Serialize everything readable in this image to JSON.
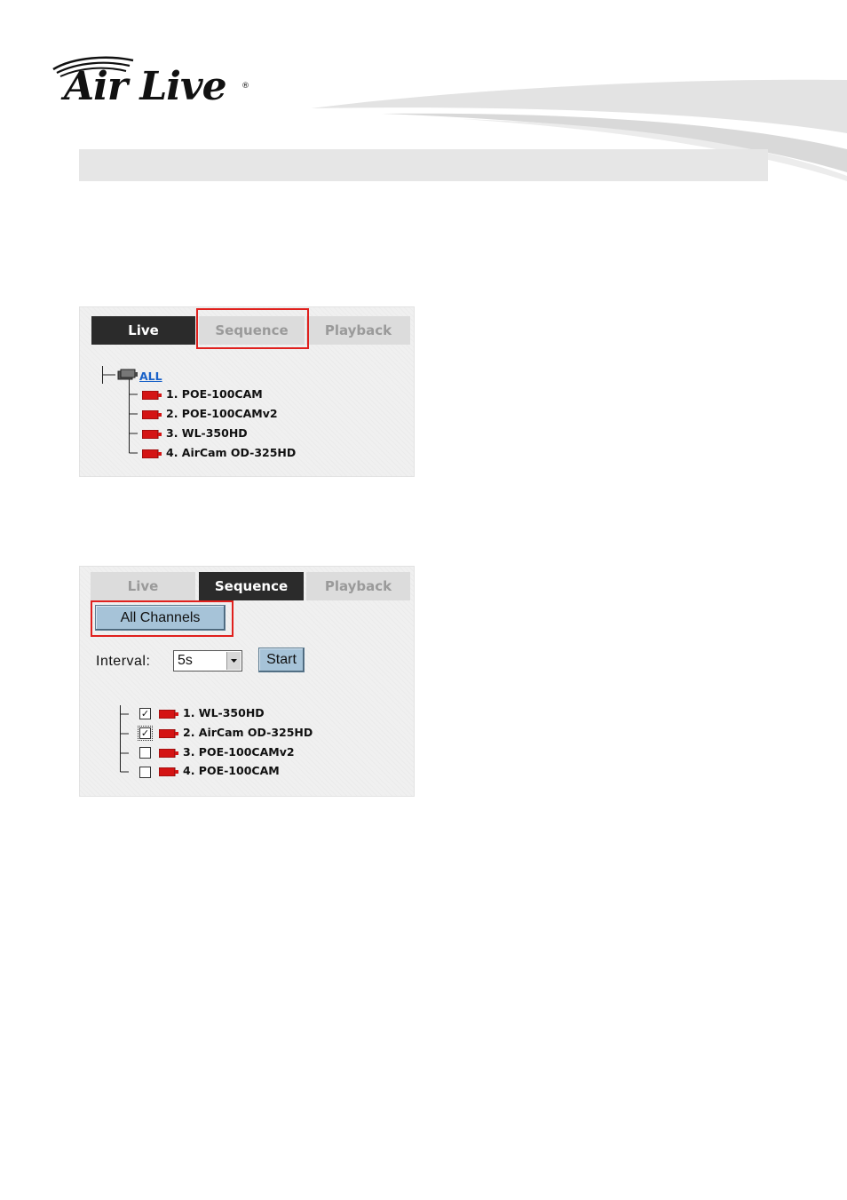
{
  "header": {
    "brand": "Air Live",
    "registered_mark": "®"
  },
  "panel_live": {
    "tabs": [
      {
        "label": "Live",
        "active": true
      },
      {
        "label": "Sequence",
        "active": false,
        "highlighted": true
      },
      {
        "label": "Playback",
        "active": false
      }
    ],
    "root_label": "ALL",
    "cameras": [
      "1. POE-100CAM",
      "2. POE-100CAMv2",
      "3. WL-350HD",
      "4. AirCam OD-325HD"
    ]
  },
  "panel_sequence": {
    "tabs": [
      {
        "label": "Live",
        "active": false
      },
      {
        "label": "Sequence",
        "active": true
      },
      {
        "label": "Playback",
        "active": false
      }
    ],
    "all_channels_button": "All Channels",
    "interval_label": "Interval:",
    "interval_value": "5s",
    "start_button": "Start",
    "cameras": [
      {
        "label": "1. WL-350HD",
        "checked": true
      },
      {
        "label": "2. AirCam OD-325HD",
        "checked": true
      },
      {
        "label": "3. POE-100CAMv2",
        "checked": false
      },
      {
        "label": "4. POE-100CAM",
        "checked": false
      }
    ]
  },
  "colors": {
    "highlight": "#e0201d",
    "tab_active": "#2b2b2b",
    "tab_inactive": "#dcdcdc",
    "button": "#a6c3d8",
    "camera_icon": "#d41414",
    "link": "#1a62c8"
  }
}
